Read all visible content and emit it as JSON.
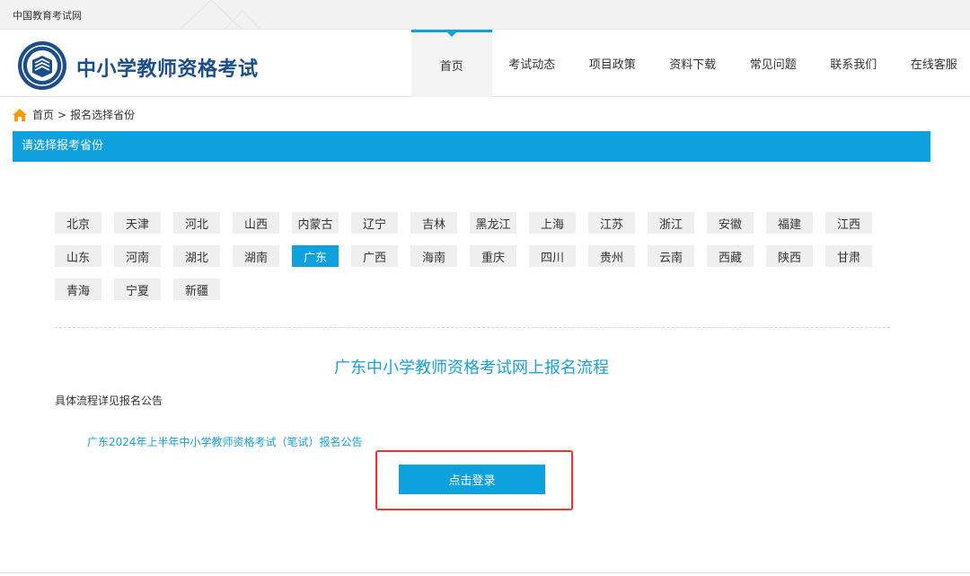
{
  "topbar": {
    "site_name": "中国教育考试网"
  },
  "header": {
    "title": "中小学教师资格考试",
    "nav": [
      {
        "label": "首页",
        "active": true
      },
      {
        "label": "考试动态"
      },
      {
        "label": "项目政策"
      },
      {
        "label": "资料下载"
      },
      {
        "label": "常见问题"
      },
      {
        "label": "联系我们"
      },
      {
        "label": "在线客服"
      }
    ]
  },
  "breadcrumb": {
    "home": "首页",
    "separator": ">",
    "current": "报名选择省份"
  },
  "section": {
    "title": "请选择报考省份"
  },
  "provinces": [
    [
      "北京",
      "天津",
      "河北",
      "山西",
      "内蒙古",
      "辽宁",
      "吉林",
      "黑龙江",
      "上海",
      "江苏",
      "浙江",
      "安徽",
      "福建",
      "江西"
    ],
    [
      "山东",
      "河南",
      "湖北",
      "湖南",
      "广东",
      "广西",
      "海南",
      "重庆",
      "四川",
      "贵州",
      "云南",
      "西藏",
      "陕西",
      "甘肃"
    ],
    [
      "青海",
      "宁夏",
      "新疆"
    ]
  ],
  "selected_province": "广东",
  "flow": {
    "title": "广东中小学教师资格考试网上报名流程",
    "detail": "具体流程详见报名公告",
    "notice_link": "广东2024年上半年中小学教师资格考试（笔试）报名公告",
    "login_button": "点击登录"
  },
  "colors": {
    "accent": "#0ea1dd",
    "title_blue": "#1a4e8c",
    "highlight": "#e53935"
  },
  "icons": {
    "home": "home-icon",
    "logo": "exam-logo-icon"
  }
}
